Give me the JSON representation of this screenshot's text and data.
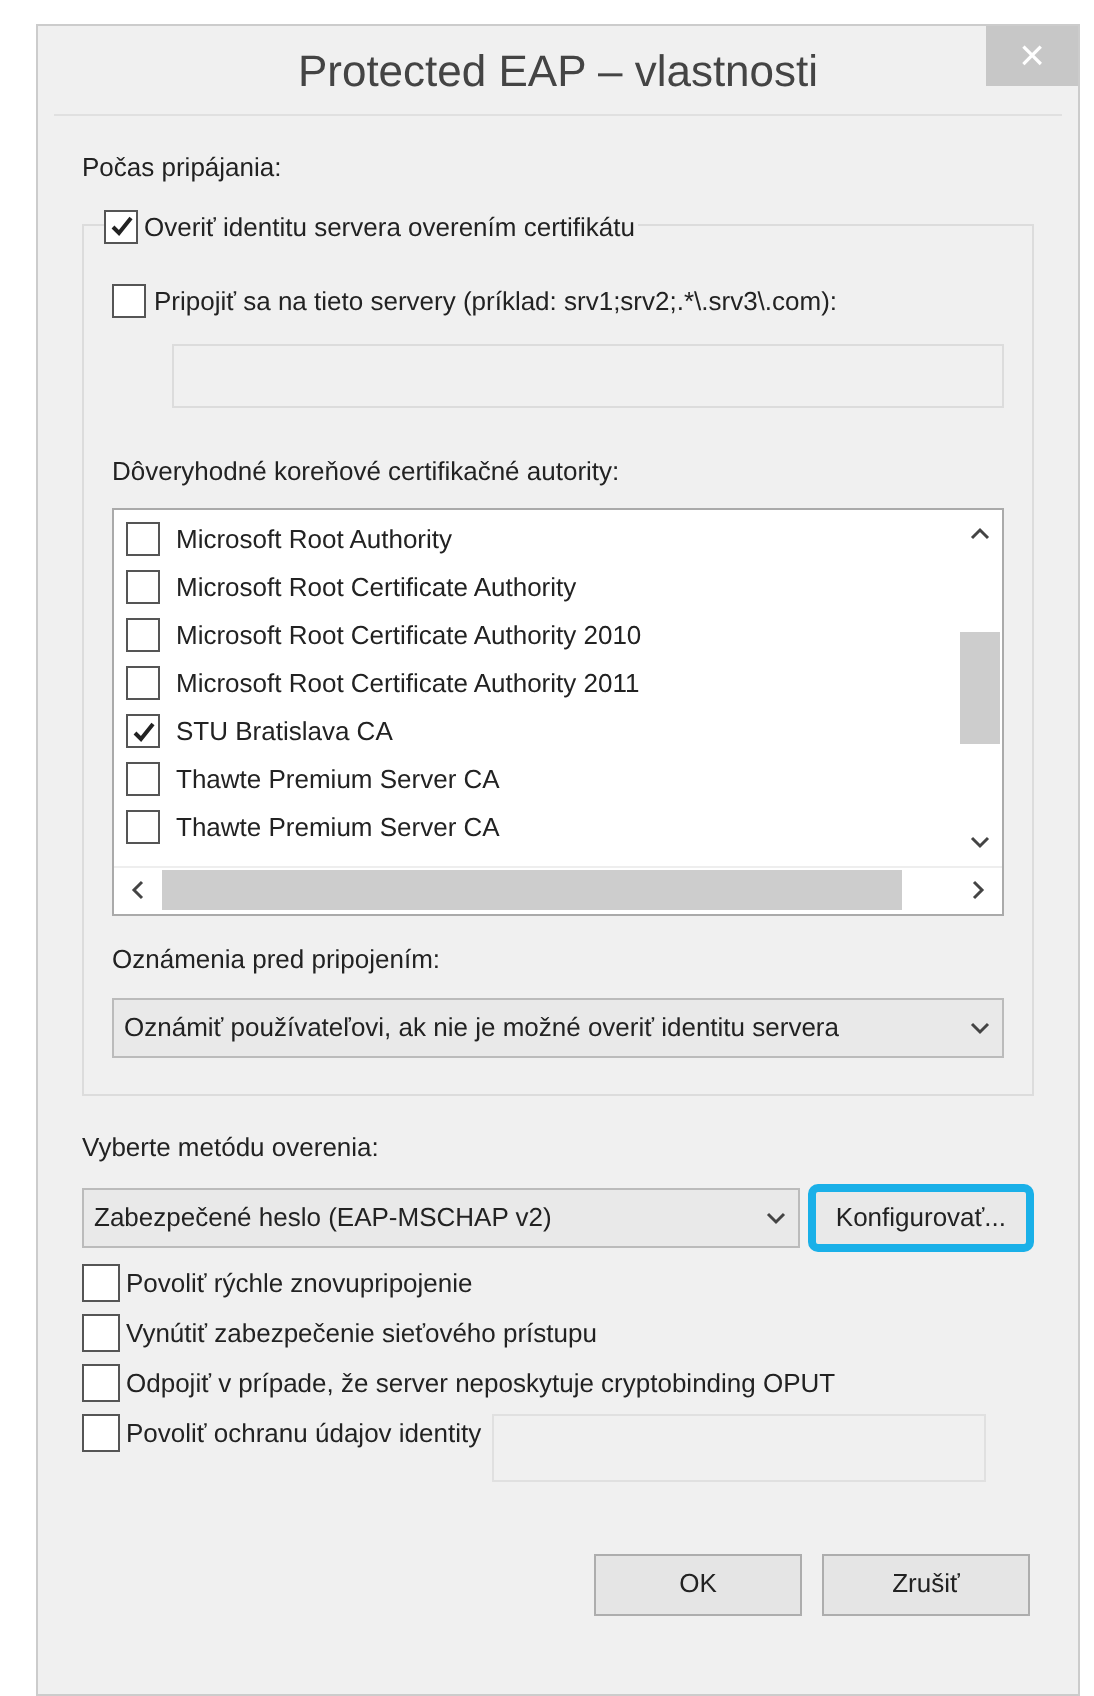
{
  "window": {
    "title": "Protected EAP – vlastnosti",
    "close": "×"
  },
  "connecting": {
    "label": "Počas pripájania:",
    "verify": {
      "label": "Overiť identitu servera overením certifikátu",
      "checked": true
    },
    "connect_to": {
      "label": "Pripojiť sa na tieto servery (príklad: srv1;srv2;.*\\.srv3\\.com):",
      "checked": false
    },
    "authorities_label": "Dôveryhodné koreňové certifikačné autority:",
    "authorities": [
      {
        "name": "Microsoft Root Authority",
        "checked": false
      },
      {
        "name": "Microsoft Root Certificate Authority",
        "checked": false
      },
      {
        "name": "Microsoft Root Certificate Authority 2010",
        "checked": false
      },
      {
        "name": "Microsoft Root Certificate Authority 2011",
        "checked": false
      },
      {
        "name": "STU Bratislava CA",
        "checked": true
      },
      {
        "name": "Thawte Premium Server CA",
        "checked": false
      },
      {
        "name": "Thawte Premium Server CA",
        "checked": false
      }
    ],
    "notify_label": "Oznámenia pred pripojením:",
    "notify_value": "Oznámiť používateľovi, ak nie je možné overiť identitu servera"
  },
  "method": {
    "label": "Vyberte metódu overenia:",
    "value": "Zabezpečené heslo (EAP-MSCHAP v2)",
    "configure": {
      "label": "Konfigurovať...",
      "highlighted": true
    }
  },
  "options": [
    {
      "label": "Povoliť rýchle znovupripojenie",
      "checked": false
    },
    {
      "label": "Vynútiť zabezpečenie sieťového prístupu",
      "checked": false
    },
    {
      "label": "Odpojiť v prípade, že server neposkytuje cryptobinding OPUT",
      "checked": false
    },
    {
      "label": "Povoliť ochranu údajov identity",
      "checked": false,
      "kind": "with-field"
    }
  ],
  "buttons": [
    "OK",
    "Zrušiť"
  ]
}
